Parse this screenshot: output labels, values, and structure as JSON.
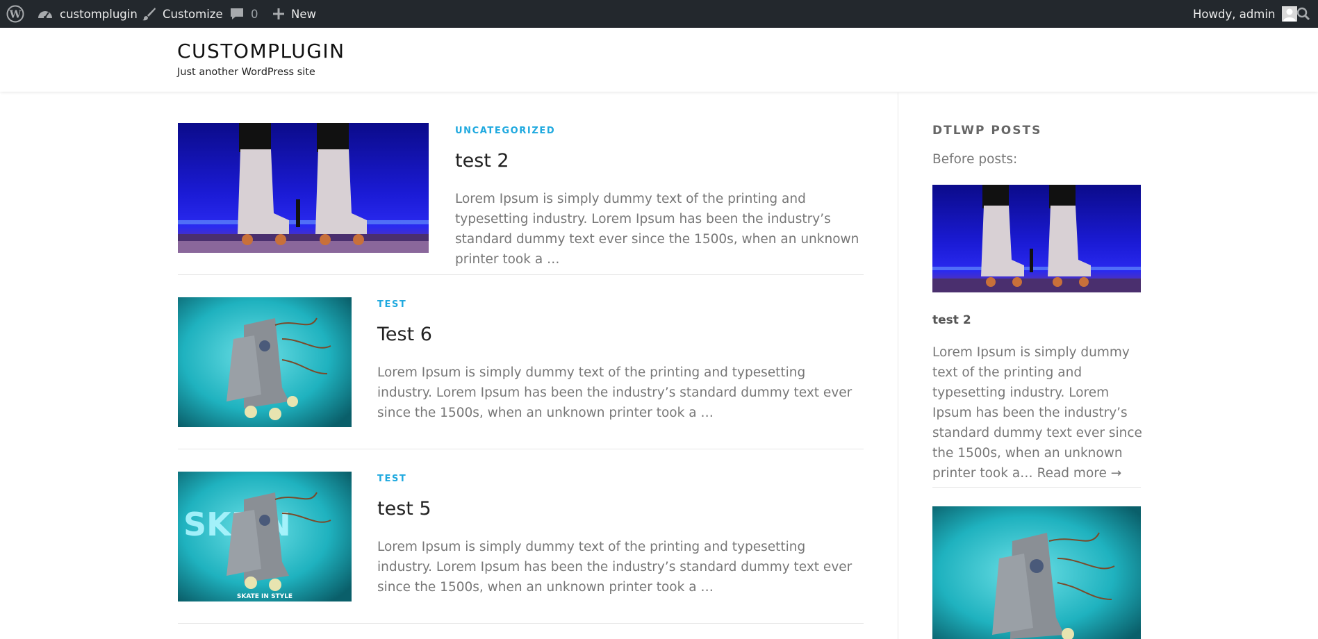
{
  "admin_bar": {
    "site_name": "customplugin",
    "customize_label": "Customize",
    "comments_count": "0",
    "new_label": "New",
    "greeting": "Howdy, admin",
    "icons": [
      "wordpress-logo-icon",
      "dashboard-gauge-icon",
      "paintbrush-icon",
      "comment-bubble-icon",
      "plus-icon",
      "avatar-icon",
      "search-icon"
    ]
  },
  "header": {
    "site_title": "CUSTOMPLUGIN",
    "tagline": "Just another WordPress site"
  },
  "posts": [
    {
      "category": "UNCATEGORIZED",
      "title": "test 2",
      "excerpt": "Lorem Ipsum is simply dummy text of the printing and typesetting industry. Lorem Ipsum has been the industry’s standard dummy text ever since the 1500s, when an unknown printer took a …"
    },
    {
      "category": "TEST",
      "title": "Test 6",
      "excerpt": "Lorem Ipsum is simply dummy text of the printing and typesetting industry. Lorem Ipsum has been the industry’s standard dummy text ever since the 1500s, when an unknown printer took a …"
    },
    {
      "category": "TEST",
      "title": "test 5",
      "excerpt": "Lorem Ipsum is simply dummy text of the printing and typesetting industry. Lorem Ipsum has been the industry’s standard dummy text ever since the 1500s, when an unknown printer took a …",
      "image_text": "SKE  N",
      "image_caption": "SKATE IN STYLE"
    }
  ],
  "sidebar": {
    "widget_title": "DTLWP POSTS",
    "before_posts": "Before posts:",
    "post": {
      "title": "test 2",
      "excerpt": "Lorem Ipsum is simply dummy text of the printing and typesetting industry. Lorem Ipsum has been the industry’s standard dummy text ever since the 1500s, when an unknown printer took a…",
      "read_more": "Read more →"
    }
  },
  "colors": {
    "admin_bar_bg": "#23282d",
    "category_accent": "#1fa9df",
    "stage_blue": "#1a1ad8",
    "teal_bg": "#1fb2bf"
  }
}
